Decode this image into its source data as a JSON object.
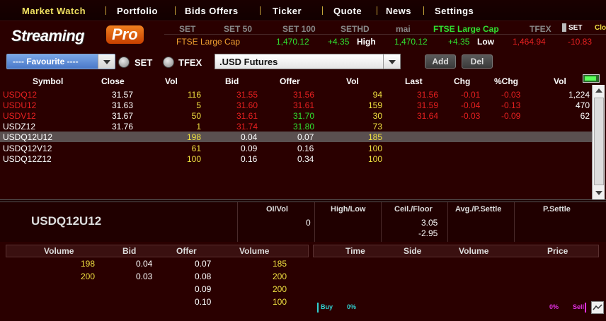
{
  "menu": {
    "items": [
      {
        "label": "Market Watch",
        "active": true
      },
      {
        "label": "Portfolio"
      },
      {
        "label": "Bids Offers"
      },
      {
        "label": "Ticker"
      },
      {
        "label": "Quote"
      },
      {
        "label": "News"
      },
      {
        "label": "Settings"
      }
    ]
  },
  "logo": {
    "text_a": "Streaming",
    "text_b": "Pro"
  },
  "index_bar": {
    "headers": [
      "SET",
      "SET 50",
      "SET 100",
      "SETHD",
      "mai",
      "FTSE Large Cap",
      "TFEX",
      "SET",
      "Clo"
    ],
    "values": {
      "name": "FTSE Large Cap",
      "v1": "1,470.12",
      "chg1": "+4.35",
      "hl1": "High",
      "v2": "1,470.12",
      "chg2": "+4.35",
      "hl2": "Low",
      "v3": "1,464.94",
      "chg3": "-10.83"
    }
  },
  "toolbar": {
    "favourite": "---- Favourite ----",
    "radio_set": "SET",
    "radio_tfex": "TFEX",
    "symbol_select": ".USD Futures",
    "add_label": "Add",
    "del_label": "Del"
  },
  "grid": {
    "headers": [
      "Symbol",
      "Close",
      "Vol",
      "Bid",
      "Offer",
      "Vol",
      "Last",
      "Chg",
      "%Chg",
      "Vol"
    ],
    "rows": [
      {
        "symbol": "USDQ12",
        "close": "31.57",
        "bidvol": "116",
        "bid": "31.55",
        "offer": "31.56",
        "offvol": "94",
        "last": "31.56",
        "chg": "-0.01",
        "pchg": "-0.03",
        "vol": "1,224",
        "symcolor": "red",
        "bidcolor": "red",
        "offcolor": "red",
        "lastcolor": "red"
      },
      {
        "symbol": "USDU12",
        "close": "31.63",
        "bidvol": "5",
        "bid": "31.60",
        "offer": "31.61",
        "offvol": "159",
        "last": "31.59",
        "chg": "-0.04",
        "pchg": "-0.13",
        "vol": "470",
        "symcolor": "red",
        "bidcolor": "red",
        "offcolor": "red",
        "lastcolor": "red"
      },
      {
        "symbol": "USDV12",
        "close": "31.67",
        "bidvol": "50",
        "bid": "31.61",
        "offer": "31.70",
        "offvol": "30",
        "last": "31.64",
        "chg": "-0.03",
        "pchg": "-0.09",
        "vol": "62",
        "symcolor": "red",
        "bidcolor": "red",
        "offcolor": "green",
        "lastcolor": "red"
      },
      {
        "symbol": "USDZ12",
        "close": "31.76",
        "bidvol": "1",
        "bid": "31.74",
        "offer": "31.80",
        "offvol": "73",
        "last": "",
        "chg": "",
        "pchg": "",
        "vol": "",
        "symcolor": "white",
        "bidcolor": "red",
        "offcolor": "green",
        "lastcolor": "white"
      },
      {
        "symbol": "USDQ12U12",
        "close": "",
        "bidvol": "198",
        "bid": "0.04",
        "offer": "0.07",
        "offvol": "185",
        "last": "",
        "chg": "",
        "pchg": "",
        "vol": "",
        "symcolor": "white",
        "bidcolor": "white",
        "offcolor": "white",
        "lastcolor": "white",
        "selected": true
      },
      {
        "symbol": "USDQ12V12",
        "close": "",
        "bidvol": "61",
        "bid": "0.09",
        "offer": "0.16",
        "offvol": "100",
        "last": "",
        "chg": "",
        "pchg": "",
        "vol": "",
        "symcolor": "white",
        "bidcolor": "white",
        "offcolor": "white",
        "lastcolor": "white"
      },
      {
        "symbol": "USDQ12Z12",
        "close": "",
        "bidvol": "100",
        "bid": "0.16",
        "offer": "0.34",
        "offvol": "100",
        "last": "",
        "chg": "",
        "pchg": "",
        "vol": "",
        "symcolor": "white",
        "bidcolor": "white",
        "offcolor": "white",
        "lastcolor": "white"
      }
    ]
  },
  "detail": {
    "symbol": "USDQ12U12",
    "labels": [
      "OI/Vol",
      "High/Low",
      "Ceil./Floor",
      "Avg./P.Settle",
      "P.Settle"
    ],
    "oi_vol": "0",
    "ceil": "3.05",
    "floor": "-2.95"
  },
  "bid_offer": {
    "headers": [
      "Volume",
      "Bid",
      "Offer",
      "Volume"
    ],
    "rows": [
      {
        "bidvol": "198",
        "bid": "0.04",
        "offer": "0.07",
        "offvol": "185"
      },
      {
        "bidvol": "200",
        "bid": "0.03",
        "offer": "0.08",
        "offvol": "200"
      },
      {
        "bidvol": "",
        "bid": "",
        "offer": "0.09",
        "offvol": "200"
      },
      {
        "bidvol": "",
        "bid": "",
        "offer": "0.10",
        "offvol": "100"
      }
    ]
  },
  "ticks": {
    "headers": [
      "Time",
      "Side",
      "Volume",
      "Price"
    ],
    "buy_label": "Buy",
    "buy_pct": "0%",
    "sell_label": "Sell",
    "sell_pct": "0%"
  },
  "colors": {
    "red": "#e82020",
    "green": "#30e030",
    "yellow": "#f0e040",
    "accent": "#f0e060"
  }
}
